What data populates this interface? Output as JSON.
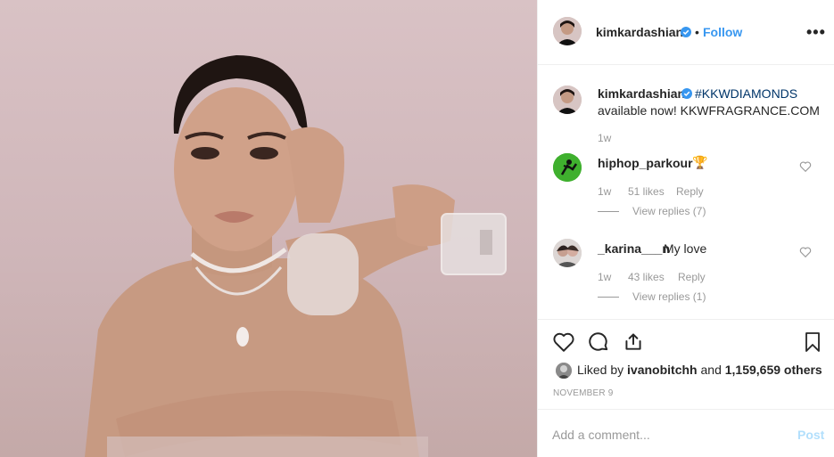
{
  "header": {
    "username": "kimkardashian",
    "separator": "•",
    "follow_label": "Follow",
    "more_label": "•••"
  },
  "caption": {
    "username": "kimkardashian",
    "hashtag": "#KKWDIAMONDS",
    "text": "available now! KKWFRAGRANCE.COM",
    "time": "1w"
  },
  "comments": [
    {
      "username": "hiphop_parkour",
      "text": "🏆",
      "time": "1w",
      "likes": "51 likes",
      "reply_label": "Reply",
      "view_replies": "View replies (7)",
      "avatar_color": "#3fb02e"
    },
    {
      "username": "_karina___n",
      "text": "My love",
      "time": "1w",
      "likes": "43 likes",
      "reply_label": "Reply",
      "view_replies": "View replies (1)",
      "avatar_color": "#cfc8c6"
    }
  ],
  "actions": {
    "icons": [
      "heart-icon",
      "comment-icon",
      "share-icon",
      "bookmark-icon"
    ]
  },
  "likes": {
    "prefix": "Liked by",
    "user": "ivanobitchh",
    "and": "and",
    "count": "1,159,659 others"
  },
  "date": "NOVEMBER 9",
  "add_comment": {
    "placeholder": "Add a comment...",
    "post_label": "Post"
  },
  "colors": {
    "accent": "#3897f0",
    "hashtag": "#003569",
    "muted": "#999999",
    "post_disabled": "#b2dffc",
    "border": "#efefef"
  }
}
